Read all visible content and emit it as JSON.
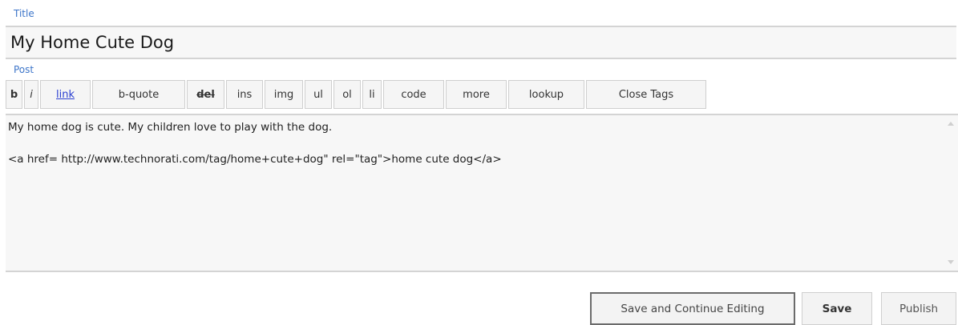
{
  "title": {
    "label": "Title",
    "value": "My Home Cute Dog"
  },
  "post": {
    "label": "Post",
    "toolbar": [
      "b",
      "i",
      "link",
      "b-quote",
      "del",
      "ins",
      "img",
      "ul",
      "ol",
      "li",
      "code",
      "more",
      "lookup",
      "Close Tags"
    ],
    "content": "My home dog is cute. My children love to play with the dog.\n\n<a href= http://www.technorati.com/tag/home+cute+dog\" rel=\"tag\">home cute dog</a>"
  },
  "actions": {
    "save_continue": "Save and Continue Editing",
    "save": "Save",
    "publish": "Publish"
  }
}
